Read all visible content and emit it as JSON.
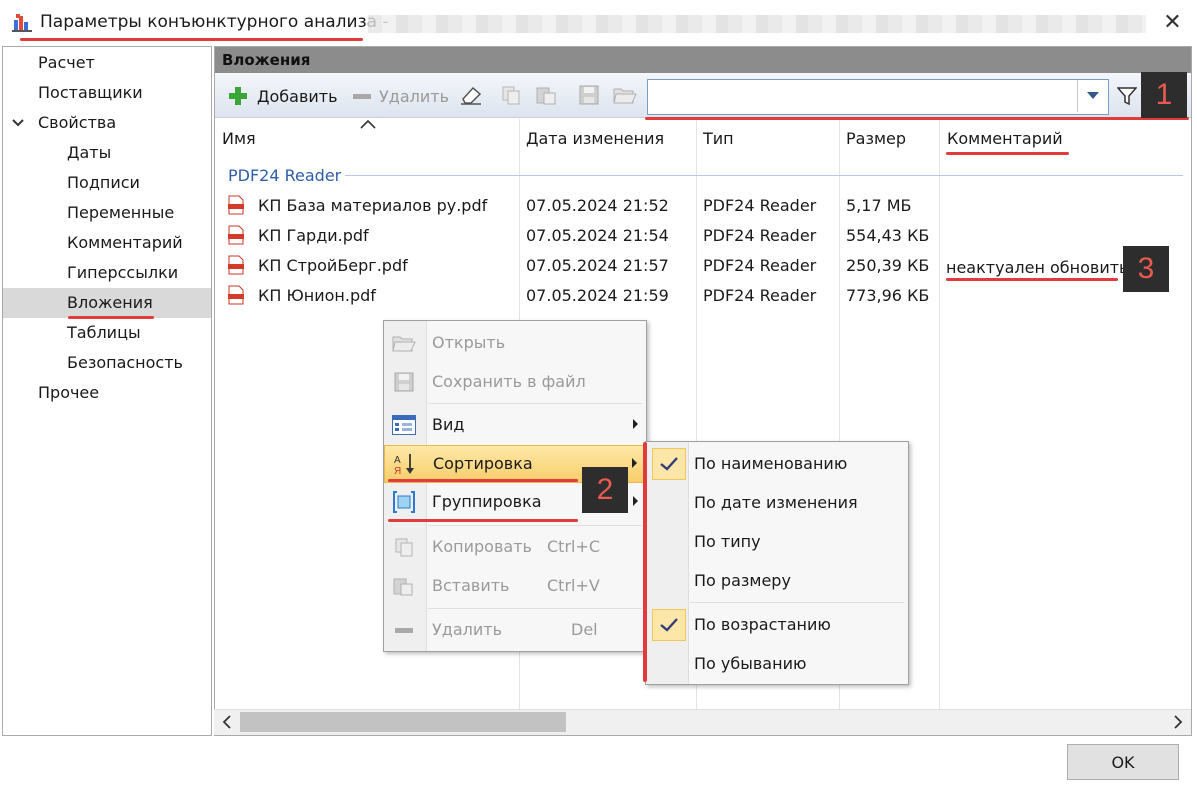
{
  "window": {
    "title": "Параметры конъюнктурного анализа -",
    "close_glyph": "✕",
    "accent": "#e23b3b"
  },
  "nav": {
    "items": [
      {
        "label": "Расчет"
      },
      {
        "label": "Поставщики"
      },
      {
        "label": "Свойства",
        "expanded": true
      },
      {
        "label": "Даты"
      },
      {
        "label": "Подписи"
      },
      {
        "label": "Переменные"
      },
      {
        "label": "Комментарий"
      },
      {
        "label": "Гиперссылки"
      },
      {
        "label": "Вложения",
        "selected": true
      },
      {
        "label": "Таблицы"
      },
      {
        "label": "Безопасность"
      },
      {
        "label": "Прочее"
      }
    ]
  },
  "pane": {
    "title": "Вложения",
    "toolbar": {
      "add_label": "Добавить",
      "delete_label": "Удалить",
      "search_value": ""
    },
    "columns": [
      "Имя",
      "Дата изменения",
      "Тип",
      "Размер",
      "Комментарий"
    ],
    "group_label": "PDF24 Reader",
    "rows": [
      {
        "name": "КП База материалов ру.pdf",
        "date": "07.05.2024 21:52",
        "type": "PDF24 Reader",
        "size": "5,17 МБ",
        "comment": ""
      },
      {
        "name": "КП Гарди.pdf",
        "date": "07.05.2024 21:54",
        "type": "PDF24 Reader",
        "size": "554,43 КБ",
        "comment": ""
      },
      {
        "name": "КП СтройБерг.pdf",
        "date": "07.05.2024 21:57",
        "type": "PDF24 Reader",
        "size": "250,39 КБ",
        "comment": "неактуален обновить"
      },
      {
        "name": "КП Юнион.pdf",
        "date": "07.05.2024 21:59",
        "type": "PDF24 Reader",
        "size": "773,96 КБ",
        "comment": ""
      }
    ]
  },
  "context_menu": {
    "open": "Открыть",
    "save_to_file": "Сохранить в файл",
    "view": "Вид",
    "sort": "Сортировка",
    "group": "Группировка",
    "copy": "Копировать",
    "copy_shortcut": "Ctrl+C",
    "paste": "Вставить",
    "paste_shortcut": "Ctrl+V",
    "delete": "Удалить",
    "delete_shortcut": "Del"
  },
  "sort_submenu": {
    "by_name": "По наименованию",
    "by_date": "По дате изменения",
    "by_type": "По типу",
    "by_size": "По размеру",
    "ascending": "По возрастанию",
    "descending": "По убыванию"
  },
  "annotations": {
    "badge1": "1",
    "badge2": "2",
    "badge3": "3"
  },
  "footer": {
    "ok_label": "OK"
  }
}
